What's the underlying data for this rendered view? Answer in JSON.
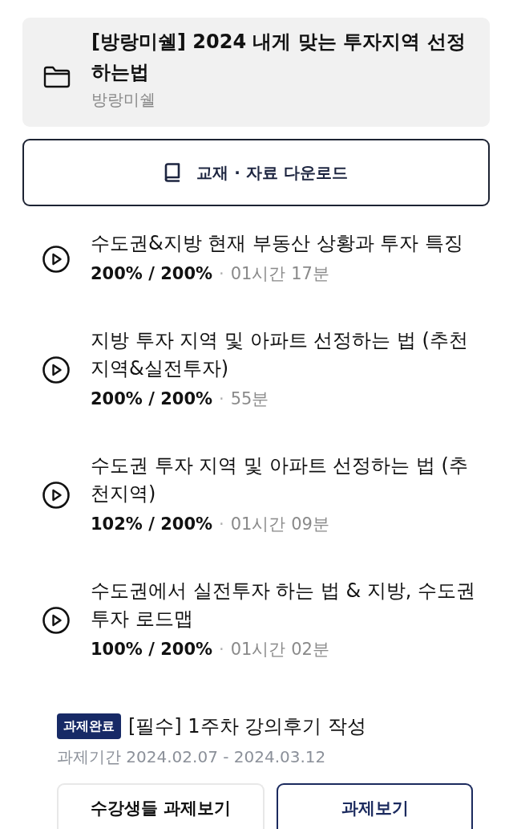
{
  "course": {
    "title": "[방랑미쉘] 2024 내게 맞는 투자지역 선정하는법",
    "author": "방랑미쉘"
  },
  "download_button": {
    "label": "교재 · 자료 다운로드"
  },
  "lessons": [
    {
      "title": "수도권&지방 현재 부동산 상황과 투자 특징",
      "progress": "200% / 200%",
      "separator": "·",
      "duration": "01시간 17분"
    },
    {
      "title": "지방 투자 지역 및 아파트 선정하는 법 (추천지역&실전투자)",
      "progress": "200% / 200%",
      "separator": "·",
      "duration": "55분"
    },
    {
      "title": "수도권 투자 지역 및 아파트 선정하는 법 (추천지역)",
      "progress": "102% / 200%",
      "separator": "·",
      "duration": "01시간 09분"
    },
    {
      "title": "수도권에서 실전투자 하는 법 & 지방, 수도권 투자 로드맵",
      "progress": "100% / 200%",
      "separator": "·",
      "duration": "01시간 02분"
    }
  ],
  "assignment": {
    "badge": "과제완료",
    "title": "[필수] 1주차 강의후기 작성",
    "period": "과제기간 2024.02.07 - 2024.03.12",
    "buttons": [
      {
        "label": "수강생들 과제보기",
        "kind": "secondary"
      },
      {
        "label": "과제보기",
        "kind": "primary"
      }
    ]
  }
}
